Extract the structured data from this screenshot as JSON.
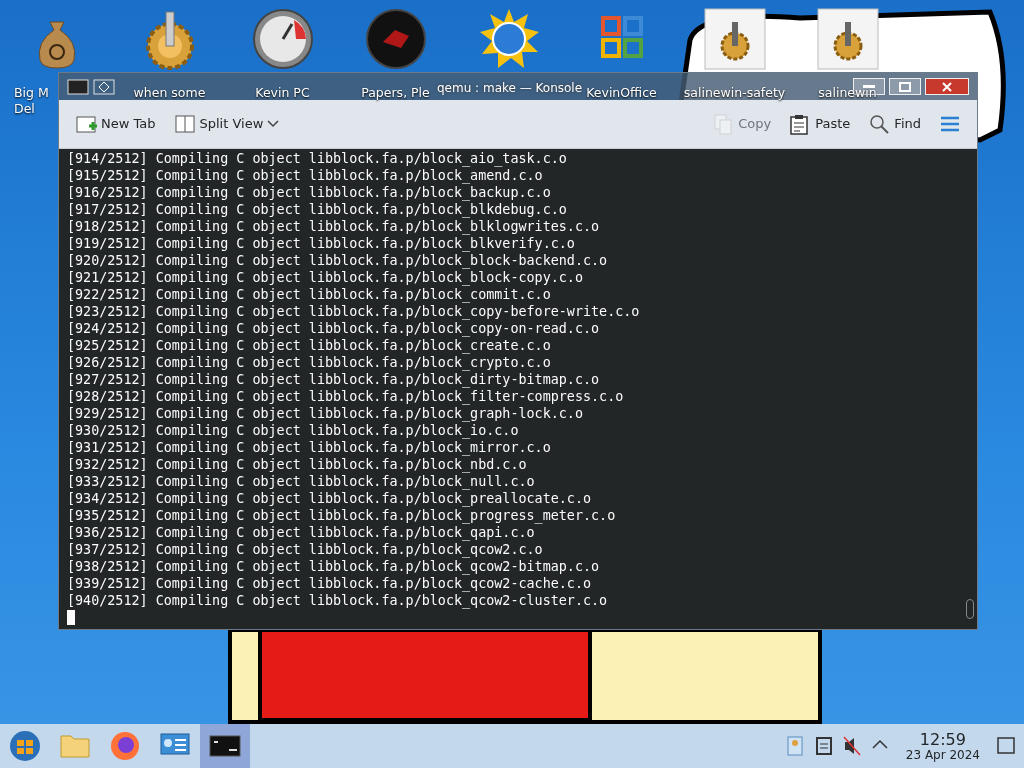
{
  "desktop_icons": [
    {
      "kind": "money-bag",
      "lines": [
        "Big M",
        "Del"
      ]
    },
    {
      "kind": "gear",
      "lines": [
        "when some"
      ]
    },
    {
      "kind": "gauge",
      "lines": [
        "Kevin PC"
      ]
    },
    {
      "kind": "dark-disc",
      "lines": [
        "Papers, Ple"
      ]
    },
    {
      "kind": "globe"
    },
    {
      "kind": "office",
      "lines": [
        "KevinOffice"
      ]
    },
    {
      "kind": "gear-tile",
      "lines": [
        "salinewin-safety"
      ]
    },
    {
      "kind": "gear-tile",
      "lines": [
        "salinewin"
      ]
    }
  ],
  "window": {
    "title": "qemu : make — Konsole",
    "toolbar_left": [
      {
        "kind": "new-tab",
        "label": "New Tab",
        "disabled": false
      },
      {
        "kind": "split",
        "label": "Split View",
        "disabled": false
      }
    ],
    "toolbar_right": [
      {
        "kind": "copy",
        "label": "Copy",
        "disabled": true
      },
      {
        "kind": "paste",
        "label": "Paste",
        "disabled": false
      },
      {
        "kind": "find",
        "label": "Find",
        "disabled": false
      },
      {
        "kind": "menu",
        "disabled": false
      }
    ],
    "terminal_lines": [
      "[914/2512] Compiling C object libblock.fa.p/block_aio_task.c.o",
      "[915/2512] Compiling C object libblock.fa.p/block_amend.c.o",
      "[916/2512] Compiling C object libblock.fa.p/block_backup.c.o",
      "[917/2512] Compiling C object libblock.fa.p/block_blkdebug.c.o",
      "[918/2512] Compiling C object libblock.fa.p/block_blklogwrites.c.o",
      "[919/2512] Compiling C object libblock.fa.p/block_blkverify.c.o",
      "[920/2512] Compiling C object libblock.fa.p/block_block-backend.c.o",
      "[921/2512] Compiling C object libblock.fa.p/block_block-copy.c.o",
      "[922/2512] Compiling C object libblock.fa.p/block_commit.c.o",
      "[923/2512] Compiling C object libblock.fa.p/block_copy-before-write.c.o",
      "[924/2512] Compiling C object libblock.fa.p/block_copy-on-read.c.o",
      "[925/2512] Compiling C object libblock.fa.p/block_create.c.o",
      "[926/2512] Compiling C object libblock.fa.p/block_crypto.c.o",
      "[927/2512] Compiling C object libblock.fa.p/block_dirty-bitmap.c.o",
      "[928/2512] Compiling C object libblock.fa.p/block_filter-compress.c.o",
      "[929/2512] Compiling C object libblock.fa.p/block_graph-lock.c.o",
      "[930/2512] Compiling C object libblock.fa.p/block_io.c.o",
      "[931/2512] Compiling C object libblock.fa.p/block_mirror.c.o",
      "[932/2512] Compiling C object libblock.fa.p/block_nbd.c.o",
      "[933/2512] Compiling C object libblock.fa.p/block_null.c.o",
      "[934/2512] Compiling C object libblock.fa.p/block_preallocate.c.o",
      "[935/2512] Compiling C object libblock.fa.p/block_progress_meter.c.o",
      "[936/2512] Compiling C object libblock.fa.p/block_qapi.c.o",
      "[937/2512] Compiling C object libblock.fa.p/block_qcow2.c.o",
      "[938/2512] Compiling C object libblock.fa.p/block_qcow2-bitmap.c.o",
      "[939/2512] Compiling C object libblock.fa.p/block_qcow2-cache.c.o",
      "[940/2512] Compiling C object libblock.fa.p/block_qcow2-cluster.c.o"
    ]
  },
  "taskbar": {
    "apps": [
      {
        "kind": "start",
        "selected": false
      },
      {
        "kind": "folder",
        "selected": false
      },
      {
        "kind": "firefox",
        "selected": false
      },
      {
        "kind": "control-panel",
        "selected": false
      },
      {
        "kind": "terminal",
        "selected": true
      }
    ],
    "tray": [
      {
        "kind": "user"
      },
      {
        "kind": "clipboard"
      },
      {
        "kind": "muted-speaker"
      },
      {
        "kind": "caret-up"
      }
    ],
    "time": "12:59",
    "date": "23 Apr 2024"
  }
}
